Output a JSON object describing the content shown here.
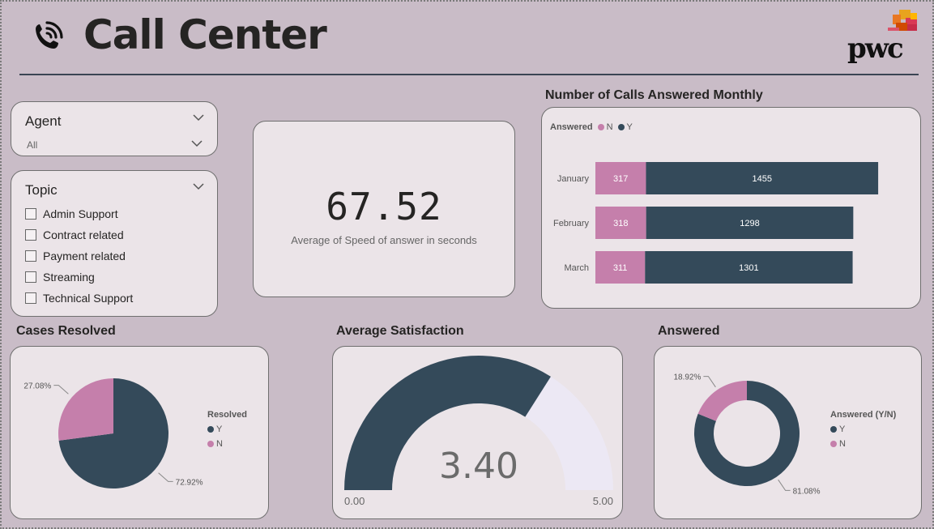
{
  "header": {
    "title": "Call Center",
    "logo_text": "pwc",
    "phone_icon": "phone-ringing-icon"
  },
  "colors": {
    "background": "#c9bcc7",
    "card": "#ebe4e8",
    "dark": "#344a5a",
    "pink": "#c57fab",
    "gauge_rest": "#ece8f4"
  },
  "agent_slicer": {
    "title": "Agent",
    "value": "All"
  },
  "topic_slicer": {
    "title": "Topic",
    "items": [
      {
        "label": "Admin Support",
        "checked": false
      },
      {
        "label": "Contract related",
        "checked": false
      },
      {
        "label": "Payment related",
        "checked": false
      },
      {
        "label": "Streaming",
        "checked": false
      },
      {
        "label": "Technical Support",
        "checked": false
      }
    ]
  },
  "kpi": {
    "value": "67.52",
    "label": "Average of Speed of answer in seconds"
  },
  "monthly_calls": {
    "title": "Number of Calls Answered Monthly",
    "legend_title": "Answered",
    "legend": [
      {
        "name": "N",
        "color": "#c57fab"
      },
      {
        "name": "Y",
        "color": "#344a5a"
      }
    ]
  },
  "cases_resolved": {
    "title": "Cases Resolved",
    "legend_title": "Resolved",
    "legend": [
      {
        "name": "Y",
        "color": "#344a5a"
      },
      {
        "name": "N",
        "color": "#c57fab"
      }
    ]
  },
  "avg_satisfaction": {
    "title": "Average Satisfaction",
    "value": "3.40",
    "min_label": "0.00",
    "max_label": "5.00"
  },
  "answered": {
    "title": "Answered",
    "legend_title": "Answered (Y/N)",
    "legend": [
      {
        "name": "Y",
        "color": "#344a5a"
      },
      {
        "name": "N",
        "color": "#c57fab"
      }
    ]
  },
  "chart_data": [
    {
      "type": "bar",
      "orientation": "horizontal-stacked",
      "title": "Number of Calls Answered Monthly",
      "categories": [
        "January",
        "February",
        "March"
      ],
      "series": [
        {
          "name": "N",
          "values": [
            317,
            318,
            311
          ]
        },
        {
          "name": "Y",
          "values": [
            1455,
            1298,
            1301
          ]
        }
      ]
    },
    {
      "type": "pie",
      "title": "Cases Resolved",
      "slices": [
        {
          "name": "Y",
          "value": 72.92,
          "label": "72.92%"
        },
        {
          "name": "N",
          "value": 27.08,
          "label": "27.08%"
        }
      ]
    },
    {
      "type": "gauge",
      "title": "Average Satisfaction",
      "value": 3.4,
      "min": 0,
      "max": 5
    },
    {
      "type": "donut",
      "title": "Answered",
      "slices": [
        {
          "name": "Y",
          "value": 81.08,
          "label": "81.08%"
        },
        {
          "name": "N",
          "value": 18.92,
          "label": "18.92%"
        }
      ]
    }
  ]
}
